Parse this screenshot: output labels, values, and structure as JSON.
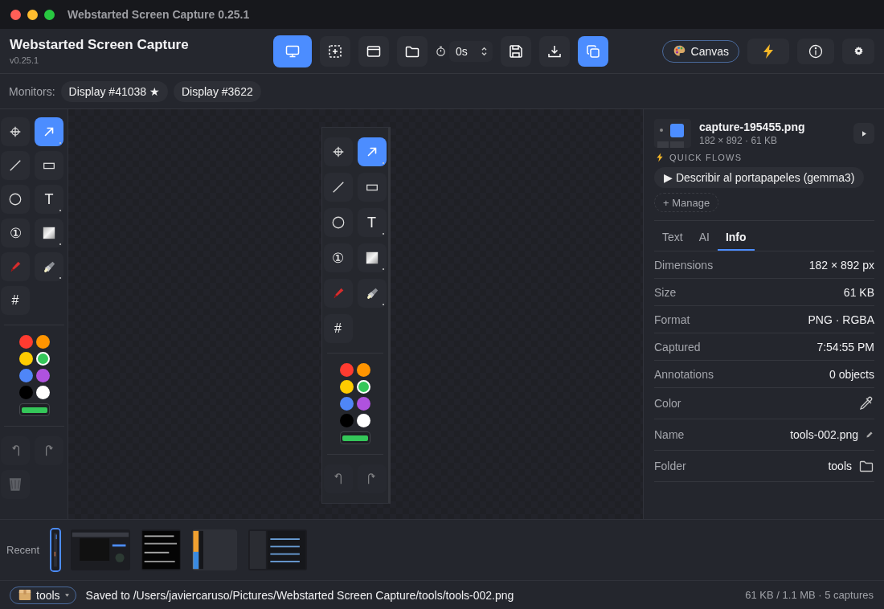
{
  "window": {
    "title": "Webstarted Screen Capture 0.25.1"
  },
  "app": {
    "name": "Webstarted Screen Capture",
    "version": "v0.25.1"
  },
  "capture_modes": [
    {
      "kind": "screen",
      "selected": true
    },
    {
      "kind": "region",
      "selected": false
    },
    {
      "kind": "window",
      "selected": false
    },
    {
      "kind": "folder",
      "selected": false
    }
  ],
  "timer": {
    "value": "0s"
  },
  "actions": [
    {
      "kind": "save",
      "on": false
    },
    {
      "kind": "download",
      "on": false
    },
    {
      "kind": "copy",
      "on": true
    }
  ],
  "canvas_button": {
    "label": "Canvas"
  },
  "monitors": {
    "label": "Monitors:",
    "items": [
      {
        "label": "Display #41038 ★"
      },
      {
        "label": "Display #3622"
      }
    ]
  },
  "tool_panel": {
    "tools": [
      {
        "kind": "crosshair",
        "selected": false,
        "submenu": false
      },
      {
        "kind": "arrow",
        "selected": true,
        "submenu": true
      },
      {
        "kind": "line",
        "selected": false,
        "submenu": false
      },
      {
        "kind": "rect",
        "selected": false,
        "submenu": false
      },
      {
        "kind": "ellipse",
        "selected": false,
        "submenu": false
      },
      {
        "kind": "text",
        "label": "T",
        "selected": false,
        "submenu": true
      },
      {
        "kind": "step",
        "label": "①",
        "selected": false,
        "submenu": false
      },
      {
        "kind": "blur",
        "selected": false,
        "submenu": true
      },
      {
        "kind": "marker",
        "selected": false,
        "submenu": false
      },
      {
        "kind": "spotlight",
        "selected": false,
        "submenu": true
      },
      {
        "kind": "grid",
        "label": "#",
        "selected": false,
        "submenu": false
      }
    ],
    "colors": [
      {
        "color": "#ff3b30",
        "selected": false
      },
      {
        "color": "#ff9500",
        "selected": false
      },
      {
        "color": "#ffcc00",
        "selected": false
      },
      {
        "color": "#34c759",
        "selected": true
      },
      {
        "color": "#4f86f7",
        "selected": false
      },
      {
        "color": "#af52de",
        "selected": false
      },
      {
        "color": "#000000",
        "selected": false
      },
      {
        "color": "#ffffff",
        "selected": false
      }
    ],
    "history": [
      {
        "kind": "undo",
        "disabled": true
      },
      {
        "kind": "redo",
        "disabled": true
      },
      {
        "kind": "trash",
        "disabled": true
      }
    ]
  },
  "canvas": {
    "capture": {
      "tools": [
        {
          "kind": "crosshair",
          "selected": false,
          "submenu": false
        },
        {
          "kind": "arrow",
          "selected": true,
          "submenu": true
        },
        {
          "kind": "line",
          "selected": false,
          "submenu": false
        },
        {
          "kind": "rect",
          "selected": false,
          "submenu": false
        },
        {
          "kind": "ellipse",
          "selected": false,
          "submenu": false
        },
        {
          "kind": "text",
          "label": "T",
          "selected": false,
          "submenu": true
        },
        {
          "kind": "step",
          "label": "①",
          "selected": false,
          "submenu": false
        },
        {
          "kind": "blur",
          "selected": false,
          "submenu": true
        },
        {
          "kind": "marker",
          "selected": false,
          "submenu": false
        },
        {
          "kind": "spotlight",
          "selected": false,
          "submenu": true
        },
        {
          "kind": "grid",
          "label": "#",
          "selected": false,
          "submenu": false
        }
      ],
      "colors": [
        {
          "color": "#ff3b30",
          "selected": false
        },
        {
          "color": "#ff9500",
          "selected": false
        },
        {
          "color": "#ffcc00",
          "selected": false
        },
        {
          "color": "#34c759",
          "selected": true
        },
        {
          "color": "#4f86f7",
          "selected": false
        },
        {
          "color": "#af52de",
          "selected": false
        },
        {
          "color": "#000000",
          "selected": false
        },
        {
          "color": "#ffffff",
          "selected": false
        }
      ],
      "history": [
        {
          "kind": "undo",
          "disabled": true
        },
        {
          "kind": "redo",
          "disabled": true
        }
      ]
    }
  },
  "file": {
    "name": "capture-195455.png",
    "meta": "182 × 892 · 61 KB"
  },
  "quick_flows": {
    "title": "QUICK FLOWS",
    "flows": [
      "▶ Describir al portapapeles (gemma3)"
    ],
    "manage": "+ Manage"
  },
  "tabs": [
    {
      "label": "Text",
      "selected": false
    },
    {
      "label": "AI",
      "selected": false
    },
    {
      "label": "Info",
      "selected": true
    }
  ],
  "info": [
    {
      "kind": "text",
      "label": "Dimensions",
      "value": "182 × 892 px"
    },
    {
      "kind": "text",
      "label": "Size",
      "value": "61 KB"
    },
    {
      "kind": "text",
      "label": "Format",
      "value": "PNG · RGBA"
    },
    {
      "kind": "text",
      "label": "Captured",
      "value": "7:54:55 PM"
    },
    {
      "kind": "text",
      "label": "Annotations",
      "value": "0 objects"
    },
    {
      "kind": "color",
      "label": "Color"
    },
    {
      "kind": "name",
      "label": "Name",
      "value": "tools-002.png"
    },
    {
      "kind": "folder",
      "label": "Folder",
      "value": "tools"
    }
  ],
  "recent": {
    "label": "Recent",
    "captures": [
      {
        "selected": true
      },
      {
        "selected": false
      },
      {
        "selected": false
      },
      {
        "selected": false
      },
      {
        "selected": false
      }
    ]
  },
  "status_bar": {
    "folder": "tools",
    "message": "Saved to /Users/javiercaruso/Pictures/Webstarted Screen Capture/tools/tools-002.png",
    "stats": "61 KB / 1.1 MB · 5 captures"
  }
}
